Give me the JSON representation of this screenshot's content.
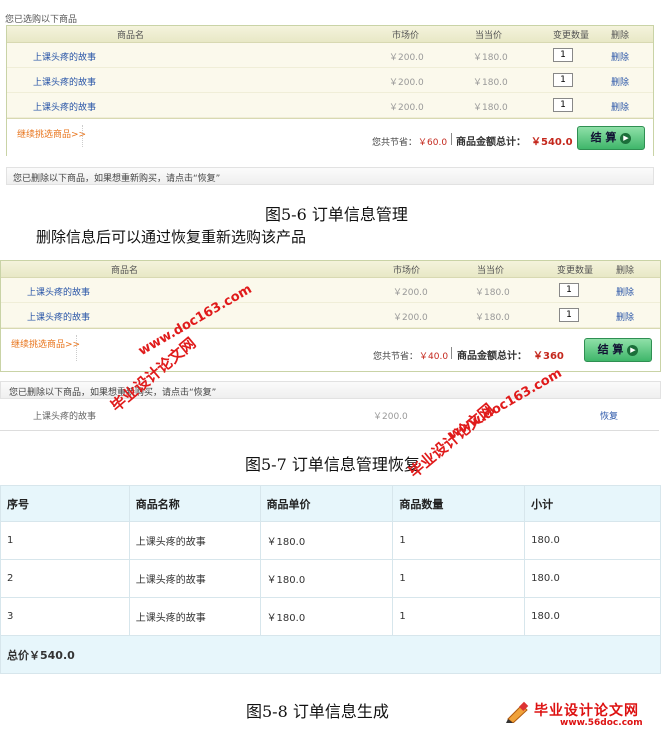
{
  "section1": {
    "title": "您已选购以下商品",
    "headers": {
      "name": "商品名",
      "market": "市场价",
      "current": "当当价",
      "qty": "变更数量",
      "del": "删除"
    },
    "rows": [
      {
        "name": "上课头疼的故事",
        "market": "￥200.0",
        "current": "￥180.0",
        "qty": "1",
        "del": "删除"
      },
      {
        "name": "上课头疼的故事",
        "market": "￥200.0",
        "current": "￥180.0",
        "qty": "1",
        "del": "删除"
      },
      {
        "name": "上课头疼的故事",
        "market": "￥200.0",
        "current": "￥180.0",
        "qty": "1",
        "del": "删除"
      }
    ],
    "continue": "继续挑选商品>>",
    "saved_label": "您共节省：",
    "saved": "￥60.0",
    "total_label": "商品金额总计：",
    "total": "￥540.0",
    "checkout": "结 算",
    "deleted_bar": "您已删除以下商品，如果想重新购买，请点击“恢复”"
  },
  "caption1": "图5-6  订单信息管理",
  "note": "删除信息后可以通过恢复重新选购该产品",
  "section2": {
    "headers": {
      "name": "商品名",
      "market": "市场价",
      "current": "当当价",
      "qty": "变更数量",
      "del": "删除"
    },
    "rows": [
      {
        "name": "上课头疼的故事",
        "market": "￥200.0",
        "current": "￥180.0",
        "qty": "1",
        "del": "删除"
      },
      {
        "name": "上课头疼的故事",
        "market": "￥200.0",
        "current": "￥180.0",
        "qty": "1",
        "del": "删除"
      }
    ],
    "continue": "继续挑选商品>>",
    "saved_label": "您共节省：",
    "saved": "￥40.0",
    "total_label": "商品金额总计：",
    "total": "￥360",
    "checkout": "结 算",
    "deleted_bar": "您已删除以下商品，如果想重新购买，请点击“恢复”",
    "deleted_row": {
      "name": "上课头疼的故事",
      "market": "￥200.0",
      "restore": "恢复"
    }
  },
  "caption2": "图5-7  订单信息管理恢复",
  "order_table": {
    "headers": [
      "序号",
      "商品名称",
      "商品单价",
      "商品数量",
      "小计"
    ],
    "rows": [
      [
        "1",
        "上课头疼的故事",
        "￥180.0",
        "1",
        "180.0"
      ],
      [
        "2",
        "上课头疼的故事",
        "￥180.0",
        "1",
        "180.0"
      ],
      [
        "3",
        "上课头疼的故事",
        "￥180.0",
        "1",
        "180.0"
      ]
    ],
    "total": "总价￥540.0"
  },
  "caption3": "图5-8  订单信息生成",
  "watermarks": {
    "cn": "毕业设计论文网",
    "url": "www.doc163.com",
    "footer_cn": "毕业设计论文网",
    "footer_url": "www.56doc.com"
  }
}
